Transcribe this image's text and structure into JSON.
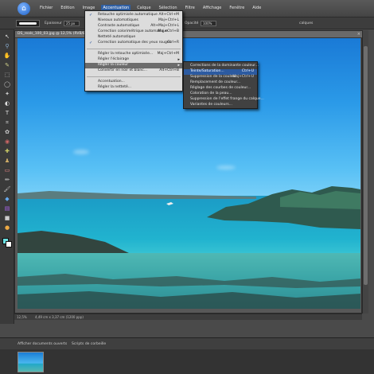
{
  "menubar": {
    "items": [
      "Fichier",
      "Edition",
      "Image",
      "Accentuation",
      "Calque",
      "Sélection",
      "Filtre",
      "Affichage",
      "Fenêtre",
      "Aide"
    ]
  },
  "options": {
    "opacity_label": "Epaisseur",
    "opacity_value": "25 px",
    "opacity_label2": "Opacité",
    "opacity_value2": "100%",
    "right_text": "calques"
  },
  "document": {
    "title": "DS_reals_100_03.jpg @ 12,5% (RVB/8*)",
    "close": "×"
  },
  "status": {
    "zoom": "12,5%",
    "size": "4,49 cm x 3,37 cm (1200 ppp)"
  },
  "bin": {
    "show_open": "Afficher documents ouverts",
    "organizer": "Scripts de corbeille"
  },
  "accentuation_menu": {
    "items": [
      {
        "label": "Retouche optimisée automatique",
        "shortcut": "Alt+Ctrl+M",
        "checked": true
      },
      {
        "label": "Niveaux automatiques",
        "shortcut": "Maj+Ctrl+L"
      },
      {
        "label": "Contraste automatique",
        "shortcut": "Alt+Maj+Ctrl+L"
      },
      {
        "label": "Correction colorimétrique automatique",
        "shortcut": "Maj+Ctrl+B"
      },
      {
        "label": "Netteté automatique",
        "shortcut": ""
      },
      {
        "label": "Correction automatique des yeux rouges",
        "shortcut": "Ctrl+R",
        "checked": true
      },
      {
        "label": "Régler la retouche optimisée...",
        "shortcut": "Maj+Ctrl+M"
      },
      {
        "label": "Régler l'éclairage",
        "shortcut": "",
        "submenu": true
      },
      {
        "label": "Régler la couleur",
        "shortcut": "",
        "submenu": true,
        "highlight": true
      },
      {
        "label": "Convertir en noir et blanc...",
        "shortcut": "Alt+Ctrl+B"
      },
      {
        "label": "Accentuation...",
        "shortcut": ""
      },
      {
        "label": "Régler la netteté...",
        "shortcut": ""
      }
    ]
  },
  "color_submenu": {
    "items": [
      {
        "label": "Corrections de la dominante couleur...",
        "shortcut": ""
      },
      {
        "label": "Teinte/Saturation...",
        "shortcut": "Ctrl+U",
        "highlight": true
      },
      {
        "label": "Suppression de la couleur",
        "shortcut": "Maj+Ctrl+U"
      },
      {
        "label": "Remplacement de couleur...",
        "shortcut": ""
      },
      {
        "label": "Réglage des courbes de couleur...",
        "shortcut": ""
      },
      {
        "label": "Coloration de la peau...",
        "shortcut": ""
      },
      {
        "label": "Suppression de l'effet frange du calque...",
        "shortcut": ""
      },
      {
        "label": "Variantes de couleurs...",
        "shortcut": ""
      }
    ]
  },
  "colors": {
    "sky": "#2b9ae8",
    "sea": "#21b3cf",
    "menu_highlight": "#2f5fa3",
    "foreground": "#6ce0e2",
    "background": "#ffffff"
  }
}
